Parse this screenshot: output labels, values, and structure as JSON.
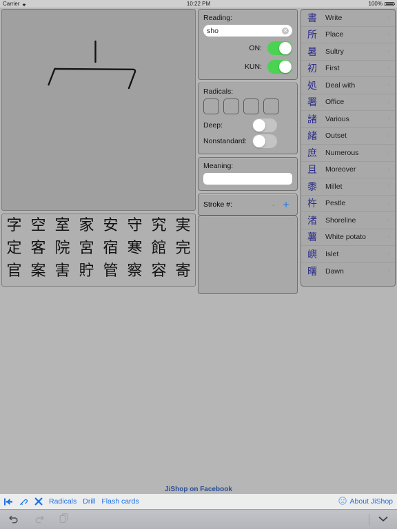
{
  "statusbar": {
    "carrier": "Carrier",
    "wifi_icon": "wifi-icon",
    "time": "10:22 PM",
    "battery_percent": "100%",
    "battery_icon": "battery-icon"
  },
  "drawing": {
    "name": "handwriting-canvas",
    "hint": "kanji radical strokes drawn by user"
  },
  "kanji_grid": {
    "rows": [
      [
        "字",
        "空",
        "室",
        "家",
        "安",
        "守",
        "究",
        "実"
      ],
      [
        "定",
        "客",
        "院",
        "宮",
        "宿",
        "寒",
        "館",
        "完"
      ],
      [
        "官",
        "案",
        "害",
        "貯",
        "管",
        "察",
        "容",
        "寄"
      ]
    ]
  },
  "reading_panel": {
    "label": "Reading:",
    "value": "sho",
    "placeholder": "",
    "clear_icon": "✕",
    "on_label": "ON:",
    "on_state": "on",
    "kun_label": "KUN:",
    "kun_state": "on"
  },
  "radicals_panel": {
    "label": "Radicals:",
    "boxes": [
      "",
      "",
      "",
      ""
    ],
    "deep_label": "Deep:",
    "deep_state": "off",
    "nonstandard_label": "Nonstandard:",
    "nonstandard_state": "off"
  },
  "meaning_panel": {
    "label": "Meaning:",
    "value": "",
    "placeholder": ""
  },
  "stroke_panel": {
    "label": "Stroke #:",
    "minus_label": "-",
    "plus_label": "+",
    "value": ""
  },
  "results_list": [
    {
      "kanji": "書",
      "meaning": "Write",
      "chevron": "›"
    },
    {
      "kanji": "所",
      "meaning": "Place",
      "chevron": "›"
    },
    {
      "kanji": "暑",
      "meaning": "Sultry",
      "chevron": "›"
    },
    {
      "kanji": "初",
      "meaning": "First",
      "chevron": "›"
    },
    {
      "kanji": "処",
      "meaning": "Deal with",
      "chevron": "›"
    },
    {
      "kanji": "署",
      "meaning": "Office",
      "chevron": "›"
    },
    {
      "kanji": "諸",
      "meaning": "Various",
      "chevron": "›"
    },
    {
      "kanji": "緒",
      "meaning": "Outset",
      "chevron": "›"
    },
    {
      "kanji": "庶",
      "meaning": "Numerous",
      "chevron": "›"
    },
    {
      "kanji": "且",
      "meaning": "Moreover",
      "chevron": "›"
    },
    {
      "kanji": "黍",
      "meaning": "Millet",
      "chevron": "›"
    },
    {
      "kanji": "杵",
      "meaning": "Pestle",
      "chevron": "›"
    },
    {
      "kanji": "渚",
      "meaning": "Shoreline",
      "chevron": "›"
    },
    {
      "kanji": "薯",
      "meaning": "White potato",
      "chevron": "›"
    },
    {
      "kanji": "嶼",
      "meaning": "Islet",
      "chevron": "›"
    },
    {
      "kanji": "曙",
      "meaning": "Dawn",
      "chevron": "›"
    }
  ],
  "facebook_link": "JiShop on Facebook",
  "toolbar": {
    "backspace_icon": "backspace-icon",
    "eraser_icon": "eraser-icon",
    "clear_icon": "clear-x-icon",
    "links": [
      "Radicals",
      "Drill",
      "Flash cards"
    ],
    "about_icon": "face-icon",
    "about_label": "About JiShop"
  },
  "keyboard_bar": {
    "undo_icon": "undo-icon",
    "redo_icon": "redo-icon",
    "paste_icon": "paste-icon",
    "dismiss_icon": "chevron-down-icon"
  },
  "colors": {
    "accent_blue": "#1f6fe5",
    "kanji_blue": "#2d2d8c",
    "toggle_on": "#4cd252",
    "toggle_off": "#c4c4c4",
    "panel_bg": "#a9a9a9",
    "page_bg": "#b6b6b6"
  }
}
